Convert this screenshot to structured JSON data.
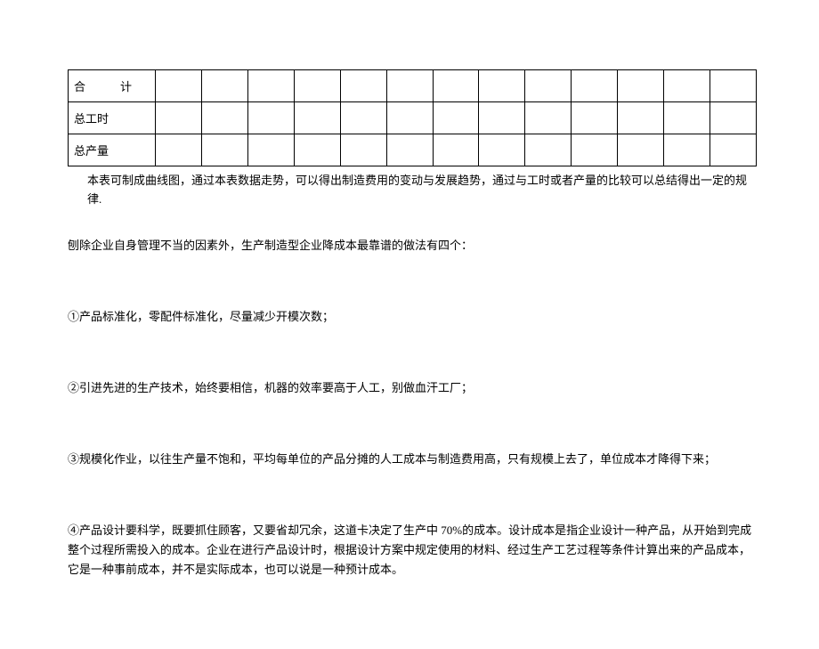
{
  "table": {
    "rows": [
      {
        "label": "合　　　计"
      },
      {
        "label": "总工时"
      },
      {
        "label": "总产量"
      }
    ],
    "empty_cols": 13
  },
  "note": "本表可制成曲线图，通过本表数据走势，可以得出制造费用的变动与发展趋势，通过与工时或者产量的比较可以总结得出一定的规律.",
  "intro": "刨除企业自身管理不当的因素外，生产制造型企业降成本最靠谱的做法有四个：",
  "items": [
    "①产品标准化，零配件标准化，尽量减少开模次数；",
    "②引进先进的生产技术，始终要相信，机器的效率要高于人工，别做血汗工厂；",
    "③规模化作业，以往生产量不饱和，平均每单位的产品分摊的人工成本与制造费用高，只有规模上去了，单位成本才降得下来；",
    "④产品设计要科学，既要抓住顾客，又要省却冗余，这道卡决定了生产中 70%的成本。设计成本是指企业设计一种产品，从开始到完成整个过程所需投入的成本。企业在进行产品设计时，根据设计方案中规定使用的材料、经过生产工艺过程等条件计算出来的产品成本，它是一种事前成本，并不是实际成本，也可以说是一种预计成本。"
  ]
}
